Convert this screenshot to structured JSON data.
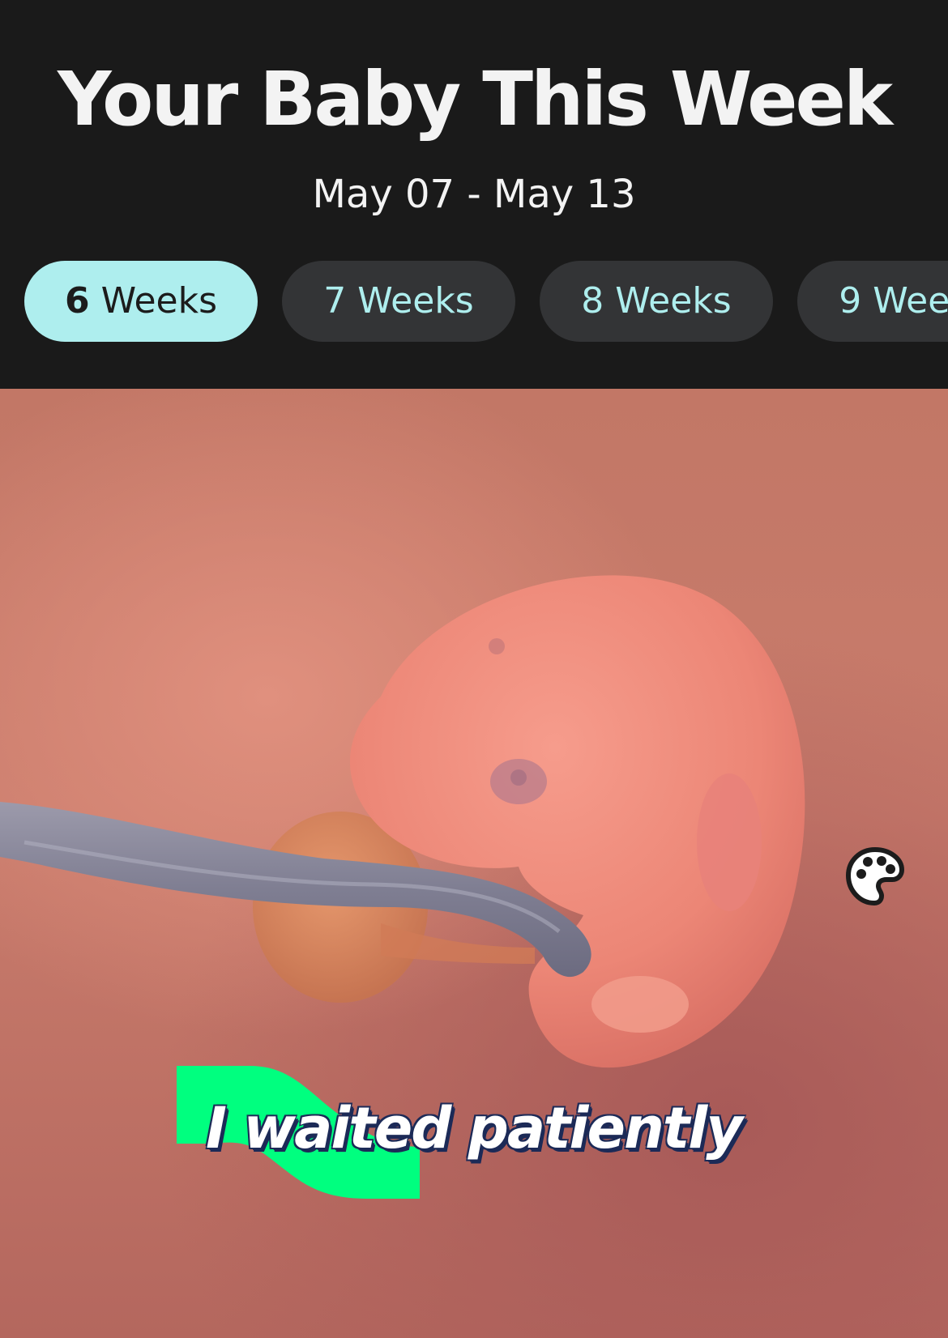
{
  "header": {
    "title": "Your Baby This Week",
    "date_range": "May 07 - May 13"
  },
  "week_tabs": [
    {
      "number": "6",
      "label": "Weeks",
      "selected": true
    },
    {
      "number": "7",
      "label": "Weeks",
      "selected": false
    },
    {
      "number": "8",
      "label": "Weeks",
      "selected": false
    },
    {
      "number": "9",
      "label": "Weeks",
      "selected": false
    }
  ],
  "media": {
    "palette_icon": "palette-icon",
    "caption": "I waited patiently",
    "caption_highlight_color": "#00ff7f"
  },
  "colors": {
    "background": "#1a1a1a",
    "tab_selected": "#aeeeee",
    "tab_unselected": "#333436",
    "tab_text": "#aeeeee"
  }
}
